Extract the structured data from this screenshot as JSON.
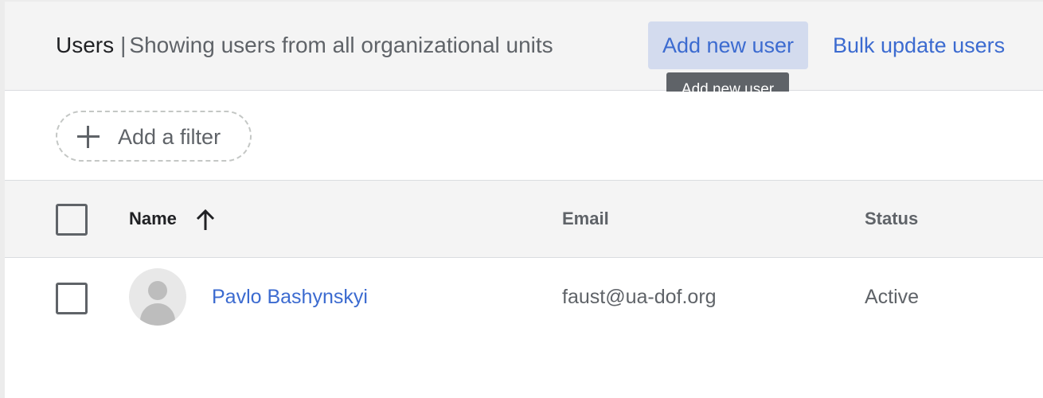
{
  "header": {
    "title": "Users",
    "separator": "|",
    "subtitle": "Showing users from all organizational units",
    "add_user_label": "Add new user",
    "bulk_update_label": "Bulk update users",
    "tooltip": "Add new user"
  },
  "filter": {
    "label": "Add a filter",
    "icon": "plus-icon"
  },
  "table": {
    "columns": {
      "name": "Name",
      "email": "Email",
      "status": "Status"
    },
    "sort": {
      "column": "name",
      "direction": "ascending",
      "icon": "arrow-up-icon"
    },
    "rows": [
      {
        "name": "Pavlo Bashynskyi",
        "email": "faust@ua-dof.org",
        "status": "Active",
        "avatar": "default-avatar-icon",
        "checked": false
      }
    ]
  },
  "colors": {
    "link": "#3c6bd0",
    "header_bg": "#f4f4f4",
    "add_button_bg": "#d3dbee",
    "tooltip_bg": "#5f6368",
    "text_primary": "#202124",
    "text_secondary": "#5f6368"
  }
}
